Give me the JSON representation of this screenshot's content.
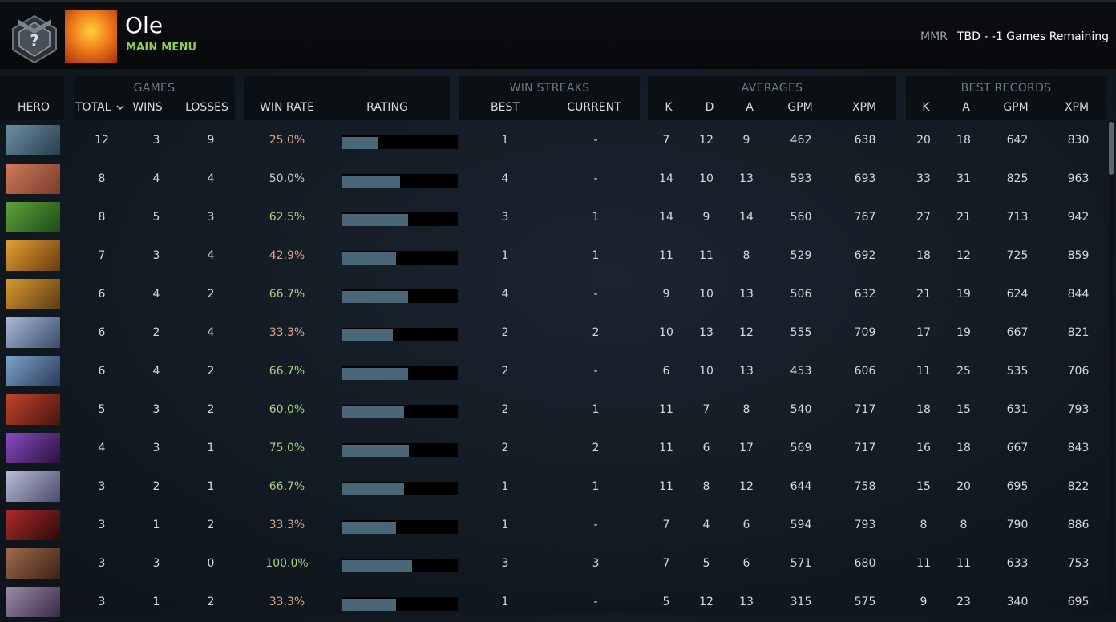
{
  "header": {
    "player_name": "Ole",
    "main_menu_label": "MAIN MENU",
    "mmr_label": "MMR",
    "mmr_value": "TBD - -1 Games Remaining",
    "rank_badge_symbol": "?"
  },
  "table": {
    "groups": {
      "games": "GAMES",
      "win_streaks": "WIN STREAKS",
      "averages": "AVERAGES",
      "best_records": "BEST RECORDS"
    },
    "columns": {
      "hero": "HERO",
      "total": "TOTAL",
      "wins": "WINS",
      "losses": "LOSSES",
      "win_rate": "WIN RATE",
      "rating": "RATING",
      "best": "BEST",
      "current": "CURRENT",
      "avg_k": "K",
      "avg_d": "D",
      "avg_a": "A",
      "avg_gpm": "GPM",
      "avg_xpm": "XPM",
      "best_k": "K",
      "best_a": "A",
      "best_gpm": "GPM",
      "best_xpm": "XPM"
    },
    "sort_icon": "chevron-down-icon",
    "rows": [
      {
        "total": "12",
        "wins": "3",
        "losses": "9",
        "win_rate": "25.0%",
        "rating": 0.32,
        "best": "1",
        "current": "-",
        "k": "7",
        "d": "12",
        "a": "9",
        "gpm": "462",
        "xpm": "638",
        "bk": "20",
        "ba": "18",
        "bgpm": "642",
        "bxpm": "830",
        "colors": [
          "#6c8fa3",
          "#2a3d4d"
        ]
      },
      {
        "total": "8",
        "wins": "4",
        "losses": "4",
        "win_rate": "50.0%",
        "rating": 0.5,
        "best": "4",
        "current": "-",
        "k": "14",
        "d": "10",
        "a": "13",
        "gpm": "593",
        "xpm": "693",
        "bk": "33",
        "ba": "31",
        "bgpm": "825",
        "bxpm": "963",
        "colors": [
          "#d07a5a",
          "#7a3a2a"
        ]
      },
      {
        "total": "8",
        "wins": "5",
        "losses": "3",
        "win_rate": "62.5%",
        "rating": 0.57,
        "best": "3",
        "current": "1",
        "k": "14",
        "d": "9",
        "a": "14",
        "gpm": "560",
        "xpm": "767",
        "bk": "27",
        "ba": "21",
        "bgpm": "713",
        "bxpm": "942",
        "colors": [
          "#5fa33a",
          "#1e4a1a"
        ]
      },
      {
        "total": "7",
        "wins": "3",
        "losses": "4",
        "win_rate": "42.9%",
        "rating": 0.47,
        "best": "1",
        "current": "1",
        "k": "11",
        "d": "11",
        "a": "8",
        "gpm": "529",
        "xpm": "692",
        "bk": "18",
        "ba": "12",
        "bgpm": "725",
        "bxpm": "859",
        "colors": [
          "#e0a030",
          "#6a3a12"
        ]
      },
      {
        "total": "6",
        "wins": "4",
        "losses": "2",
        "win_rate": "66.7%",
        "rating": 0.57,
        "best": "4",
        "current": "-",
        "k": "9",
        "d": "10",
        "a": "13",
        "gpm": "506",
        "xpm": "632",
        "bk": "21",
        "ba": "19",
        "bgpm": "624",
        "bxpm": "844",
        "colors": [
          "#d89a2e",
          "#5a3a12"
        ]
      },
      {
        "total": "6",
        "wins": "2",
        "losses": "4",
        "win_rate": "33.3%",
        "rating": 0.44,
        "best": "2",
        "current": "2",
        "k": "10",
        "d": "13",
        "a": "12",
        "gpm": "555",
        "xpm": "709",
        "bk": "17",
        "ba": "19",
        "bgpm": "667",
        "bxpm": "821",
        "colors": [
          "#a9b8d6",
          "#3a4a6a"
        ]
      },
      {
        "total": "6",
        "wins": "4",
        "losses": "2",
        "win_rate": "66.7%",
        "rating": 0.57,
        "best": "2",
        "current": "-",
        "k": "6",
        "d": "10",
        "a": "13",
        "gpm": "453",
        "xpm": "606",
        "bk": "11",
        "ba": "25",
        "bgpm": "535",
        "bxpm": "706",
        "colors": [
          "#7aa3c8",
          "#2a3a5a"
        ]
      },
      {
        "total": "5",
        "wins": "3",
        "losses": "2",
        "win_rate": "60.0%",
        "rating": 0.54,
        "best": "2",
        "current": "1",
        "k": "11",
        "d": "7",
        "a": "8",
        "gpm": "540",
        "xpm": "717",
        "bk": "18",
        "ba": "15",
        "bgpm": "631",
        "bxpm": "793",
        "colors": [
          "#c0442a",
          "#4a1410"
        ]
      },
      {
        "total": "4",
        "wins": "3",
        "losses": "1",
        "win_rate": "75.0%",
        "rating": 0.58,
        "best": "2",
        "current": "2",
        "k": "11",
        "d": "6",
        "a": "17",
        "gpm": "569",
        "xpm": "717",
        "bk": "16",
        "ba": "18",
        "bgpm": "667",
        "bxpm": "843",
        "colors": [
          "#8a4ac0",
          "#2a1240"
        ]
      },
      {
        "total": "3",
        "wins": "2",
        "losses": "1",
        "win_rate": "66.7%",
        "rating": 0.54,
        "best": "1",
        "current": "1",
        "k": "11",
        "d": "8",
        "a": "12",
        "gpm": "644",
        "xpm": "758",
        "bk": "15",
        "ba": "20",
        "bgpm": "695",
        "bxpm": "822",
        "colors": [
          "#b8bcd8",
          "#4a4a6a"
        ]
      },
      {
        "total": "3",
        "wins": "1",
        "losses": "2",
        "win_rate": "33.3%",
        "rating": 0.47,
        "best": "1",
        "current": "-",
        "k": "7",
        "d": "4",
        "a": "6",
        "gpm": "594",
        "xpm": "793",
        "bk": "8",
        "ba": "8",
        "bgpm": "790",
        "bxpm": "886",
        "colors": [
          "#b02a2a",
          "#2a0a0a"
        ]
      },
      {
        "total": "3",
        "wins": "3",
        "losses": "0",
        "win_rate": "100.0%",
        "rating": 0.61,
        "best": "3",
        "current": "3",
        "k": "7",
        "d": "5",
        "a": "6",
        "gpm": "571",
        "xpm": "680",
        "bk": "11",
        "ba": "11",
        "bgpm": "633",
        "bxpm": "753",
        "colors": [
          "#a06a4a",
          "#3a2218"
        ]
      },
      {
        "total": "3",
        "wins": "1",
        "losses": "2",
        "win_rate": "33.3%",
        "rating": 0.47,
        "best": "1",
        "current": "-",
        "k": "5",
        "d": "12",
        "a": "13",
        "gpm": "315",
        "xpm": "575",
        "bk": "9",
        "ba": "23",
        "bgpm": "340",
        "bxpm": "695",
        "colors": [
          "#9a8aa8",
          "#3a2a48"
        ]
      }
    ]
  },
  "colors": {
    "win_rate_good": "#a6d28a",
    "win_rate_bad": "#d9a58f",
    "rating_fill": "#4b6677",
    "accent_green": "#8fcb5c"
  }
}
